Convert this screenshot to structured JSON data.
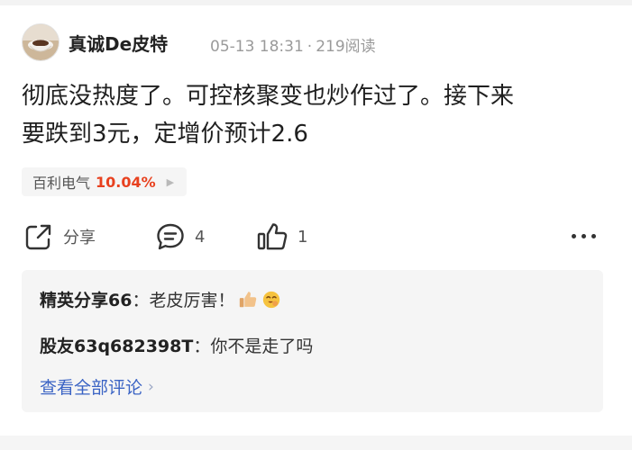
{
  "post": {
    "author": "真诚De皮特",
    "date": "05-13 18:31",
    "reads": "219阅读",
    "separator": "·",
    "content_line1": "彻底没热度了。可控核聚变也炒作过了。接下来",
    "content_line2": "要跌到3元，定增价预计2.6"
  },
  "stock_tag": {
    "name": "百利电气",
    "change": "10.04%",
    "arrow_icon": "triangle-right-icon",
    "change_color": "#e8411f"
  },
  "actions": {
    "share_label": "分享",
    "comment_count": "4",
    "like_count": "1",
    "more_icon": "ellipsis-icon"
  },
  "comments": [
    {
      "user": "精英分享66",
      "text": "：老皮厉害！",
      "emojis": [
        "thumbs-up-icon",
        "laughing-face-icon"
      ]
    },
    {
      "user": "股友63q682398T",
      "text": "：你不是走了吗"
    }
  ],
  "view_all": {
    "label": "查看全部评论",
    "link_color": "#3a63c4"
  }
}
